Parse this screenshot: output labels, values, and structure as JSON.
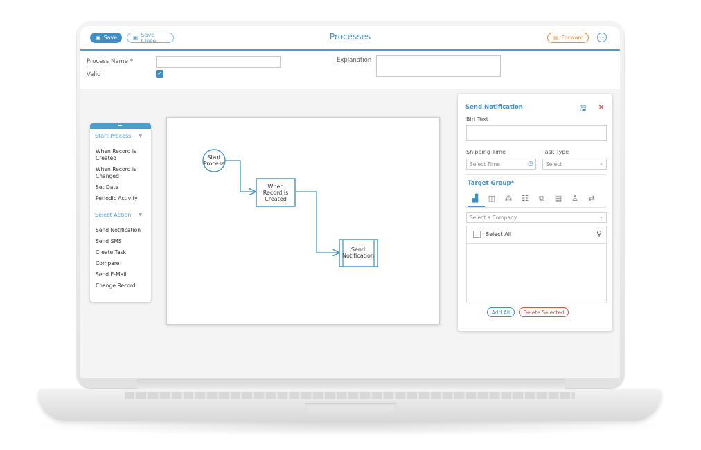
{
  "header": {
    "save_label": "Save",
    "save_close_label": "Save Close",
    "title": "Processes",
    "forward_label": "Forward",
    "more_glyph": "···"
  },
  "form": {
    "process_name_label": "Process Name *",
    "valid_label": "Valid",
    "valid_checked": true,
    "explanation_label": "Explanation",
    "process_name_value": "",
    "explanation_value": ""
  },
  "palette": {
    "start_section": "Start Process",
    "start_items": [
      "When Record is Created",
      "When Record is Changed",
      "Set Date",
      "Periodic Activity"
    ],
    "action_section": "Select Action",
    "action_items": [
      "Send Notification",
      "Send SMS",
      "Create Task",
      "Compare",
      "Send E-Mail",
      "Change Record"
    ]
  },
  "flow": {
    "start_node": "Start Process",
    "trigger_node": "When Record is Created",
    "action_node": "Send Notification",
    "color": "#3f8fc4"
  },
  "panel": {
    "title": "Send Notification",
    "biri_text_label": "Biri Text",
    "shipping_time_label": "Shipping Time",
    "shipping_time_placeholder": "Select Time",
    "task_type_label": "Task Type",
    "task_type_value": "Select",
    "target_group_label": "Target Group*",
    "company_placeholder": "Select a Company",
    "select_all_label": "Select All",
    "add_all_label": "Add All",
    "delete_selected_label": "Delete Selected",
    "target_icons": [
      "company-icon",
      "department-icon",
      "hierarchy-icon",
      "group-icon",
      "copy-icon",
      "card-icon",
      "user-icon",
      "transfer-icon"
    ]
  },
  "colors": {
    "accent": "#3f8fc4",
    "forward": "#ef8d3a",
    "close": "#e04b4b"
  }
}
